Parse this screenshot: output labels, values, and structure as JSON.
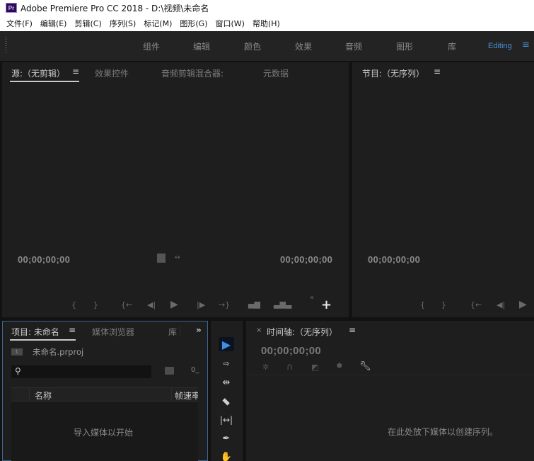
{
  "window": {
    "app_icon": "Pr",
    "title": "Adobe Premiere Pro CC 2018 - D:\\视频\\未命名"
  },
  "menu": {
    "items": [
      "文件(F)",
      "编辑(E)",
      "剪辑(C)",
      "序列(S)",
      "标记(M)",
      "图形(G)",
      "窗口(W)",
      "帮助(H)"
    ]
  },
  "workspaces": {
    "tabs": [
      "组件",
      "编辑",
      "颜色",
      "效果",
      "音频",
      "图形",
      "库"
    ],
    "active": "Editing",
    "menu_icon": "≡"
  },
  "source_panel": {
    "tabs": [
      "源:（无剪辑）",
      "效果控件",
      "音频剪辑混合器:",
      "元数据"
    ],
    "menu_icon": "≡",
    "timecode_left": "00;00;00;00",
    "timecode_right": "00;00;00;00",
    "controls": [
      "mark-in",
      "mark-out",
      "go-to-in",
      "step-back",
      "play",
      "step-forward",
      "go-to-out",
      "insert",
      "overwrite"
    ],
    "more": "»",
    "add": "+"
  },
  "program_panel": {
    "tab": "节目:（无序列）",
    "menu_icon": "≡",
    "timecode": "00;00;00;00"
  },
  "project_panel": {
    "tabs": [
      "项目: 未命名",
      "媒体浏览器",
      "库"
    ],
    "menu_icon": "≡",
    "more": "»",
    "project_file": "未命名.prproj",
    "search_placeholder": "",
    "item_count": "0_",
    "columns": [
      "名称",
      "帧速率"
    ],
    "empty_message": "导入媒体以开始"
  },
  "tools": {
    "items": [
      "selection",
      "track-select-forward",
      "ripple-edit",
      "razor",
      "slip",
      "pen",
      "hand"
    ]
  },
  "timeline_panel": {
    "close": "×",
    "title": "时间轴:（无序列）",
    "menu_icon": "≡",
    "timecode": "00;00;00;00",
    "empty_message": "在此处放下媒体以创建序列。"
  },
  "colors": {
    "accent": "#4a8fd8",
    "panel_bg": "#1e1e1e",
    "focus_border": "#3f6590"
  }
}
